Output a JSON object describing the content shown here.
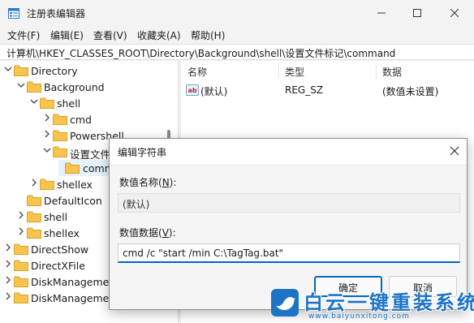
{
  "window": {
    "title": "注册表编辑器",
    "menu": [
      "文件(F)",
      "编辑(E)",
      "查看(V)",
      "收藏夹(A)",
      "帮助(H)"
    ],
    "address": "计算机\\HKEY_CLASSES_ROOT\\Directory\\Background\\shell\\设置文件标记\\command"
  },
  "tree": {
    "items": [
      {
        "label": "Directory",
        "expanded": true
      },
      {
        "label": "Background",
        "expanded": true
      },
      {
        "label": "shell",
        "expanded": true
      },
      {
        "label": "cmd",
        "expanded": false
      },
      {
        "label": "Powershell",
        "expanded": false
      },
      {
        "label": "设置文件",
        "expanded": true
      },
      {
        "label": "comm",
        "selected": true
      },
      {
        "label": "shellex",
        "expanded": false
      },
      {
        "label": "DefaultIcon"
      },
      {
        "label": "shell",
        "expanded": false
      },
      {
        "label": "shellex",
        "expanded": false
      },
      {
        "label": "DirectShow",
        "expanded": false
      },
      {
        "label": "DirectXFile",
        "expanded": false
      },
      {
        "label": "DiskManagemen",
        "expanded": false
      },
      {
        "label": "DiskManagemen",
        "expanded": false
      }
    ]
  },
  "list": {
    "headers": [
      "名称",
      "类型",
      "数据"
    ],
    "rows": [
      {
        "name": "(默认)",
        "type": "REG_SZ",
        "data": "(数值未设置)"
      }
    ]
  },
  "dialog": {
    "title": "编辑字符串",
    "name_label_prefix": "数值名称(",
    "name_label_key": "N",
    "name_label_suffix": "):",
    "name_value": "(默认)",
    "data_label_prefix": "数值数据(",
    "data_label_key": "V",
    "data_label_suffix": "):",
    "data_value": "cmd /c \"start /min C:\\TagTag.bat\"",
    "ok_label": "确定",
    "cancel_label": "取消"
  },
  "watermark": {
    "title": "白云一键重装系统",
    "url": "www.baiyunxitong.com"
  },
  "colors": {
    "accent": "#0067c0",
    "folder": "#f8c44e",
    "watermark": "#1d74c7"
  }
}
